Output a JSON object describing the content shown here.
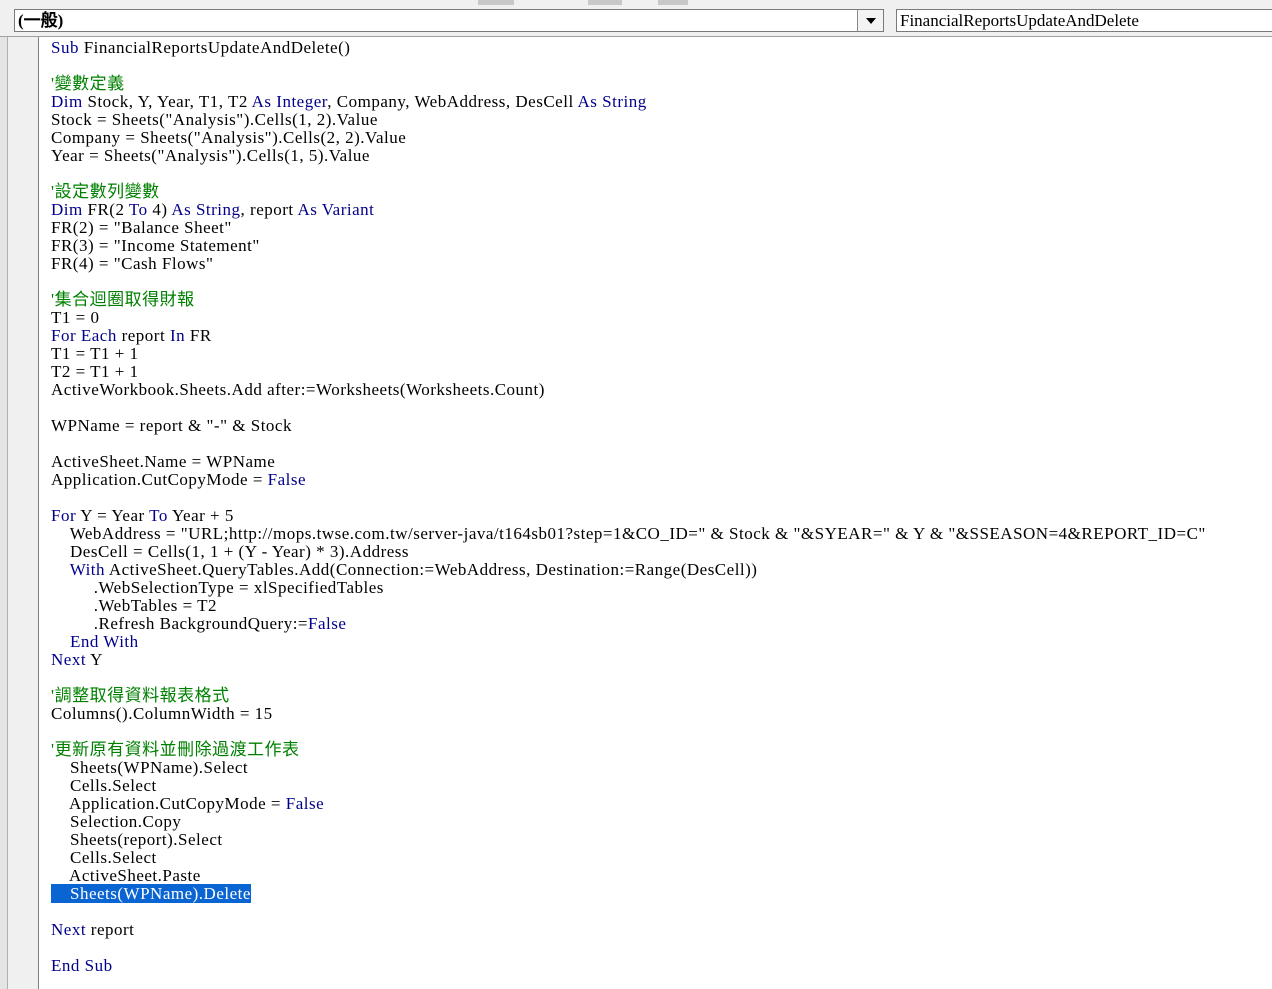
{
  "header": {
    "object_combo": "(一般)",
    "procedure_combo": "FinancialReportsUpdateAndDelete"
  },
  "icons": {
    "dropdown": "chevron-down-icon"
  },
  "colors": {
    "keyword": "#00008b",
    "comment": "#008000",
    "selection": "#0a64d2"
  },
  "code": {
    "l1": {
      "kw": "Sub",
      "t": " FinancialReportsUpdateAndDelete()"
    },
    "l3": "'變數定義",
    "l4": {
      "kw1": "Dim",
      "t1": " Stock, Y, Year, T1, T2 ",
      "kw2": "As Integer",
      "t2": ", Company, WebAddress, DesCell ",
      "kw3": "As String"
    },
    "l5": "Stock = Sheets(\"Analysis\").Cells(1, 2).Value",
    "l6": "Company = Sheets(\"Analysis\").Cells(2, 2).Value",
    "l7": "Year = Sheets(\"Analysis\").Cells(1, 5).Value",
    "l9": "'設定數列變數",
    "l10": {
      "kw1": "Dim",
      "t1": " FR(2 ",
      "kw2": "To",
      "t2": " 4) ",
      "kw3": "As String",
      "t3": ", report ",
      "kw4": "As Variant"
    },
    "l11": "FR(2) = \"Balance Sheet\"",
    "l12": "FR(3) = \"Income Statement\"",
    "l13": "FR(4) = \"Cash Flows\"",
    "l15": "'集合迴圈取得財報",
    "l16": "T1 = 0",
    "l17": {
      "kw1": "For Each",
      "t1": " report ",
      "kw2": "In",
      "t2": " FR"
    },
    "l18": "T1 = T1 + 1",
    "l19": "T2 = T1 + 1",
    "l20": "ActiveWorkbook.Sheets.Add after:=Worksheets(Worksheets.Count)",
    "l22": "WPName = report & \"-\" & Stock",
    "l24": "ActiveSheet.Name = WPName",
    "l25": {
      "t1": "Application.CutCopyMode = ",
      "kw1": "False"
    },
    "l27": {
      "kw1": "For",
      "t1": " Y = Year ",
      "kw2": "To",
      "t2": " Year + 5"
    },
    "l28": "    WebAddress = \"URL;http://mops.twse.com.tw/server-java/t164sb01?step=1&CO_ID=\" & Stock & \"&SYEAR=\" & Y & \"&SSEASON=4&REPORT_ID=C\"",
    "l29": "    DesCell = Cells(1, 1 + (Y - Year) * 3).Address",
    "l30": {
      "lead": "    ",
      "kw1": "With",
      "t1": " ActiveSheet.QueryTables.Add(Connection:=WebAddress, Destination:=Range(DesCell))"
    },
    "l31": "         .WebSelectionType = xlSpecifiedTables",
    "l32": "         .WebTables = T2",
    "l33": {
      "t1": "         .Refresh BackgroundQuery:=",
      "kw1": "False"
    },
    "l34": {
      "lead": "    ",
      "kw1": "End With"
    },
    "l35": {
      "kw1": "Next",
      "t1": " Y"
    },
    "l37": "'調整取得資料報表格式",
    "l38": "Columns().ColumnWidth = 15",
    "l40": "'更新原有資料並刪除過渡工作表",
    "l41": "    Sheets(WPName).Select",
    "l42": "    Cells.Select",
    "l43": {
      "t1": "    Application.CutCopyMode = ",
      "kw1": "False"
    },
    "l44": "    Selection.Copy",
    "l45": "    Sheets(report).Select",
    "l46": "    Cells.Select",
    "l47": "    ActiveSheet.Paste",
    "l48": "    Sheets(WPName).Delete",
    "l50": {
      "kw1": "Next",
      "t1": " report"
    },
    "l52": {
      "kw1": "End Sub"
    }
  }
}
